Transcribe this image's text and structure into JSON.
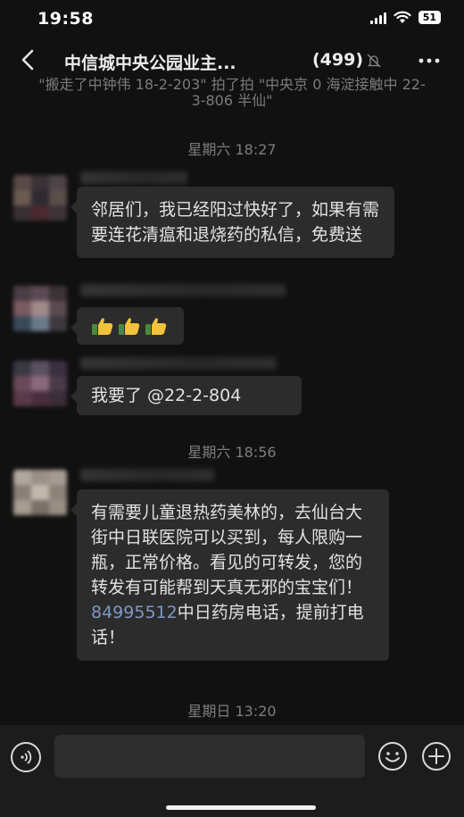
{
  "status_bar": {
    "time": "19:58",
    "battery": "51"
  },
  "chat": {
    "title": "中信城中央公园业主...",
    "member_count": "(499)"
  },
  "system_note": "\"搬走了中钟伟 18-2-203\" 拍了拍 \"中央京 0 海淀接触中 22-3-806 半仙\"",
  "messages": [
    {
      "type": "timestamp",
      "text": "星期六 18:27"
    },
    {
      "type": "text",
      "text": "邻居们，我已经阳过快好了，如果有需要连花清瘟和退烧药的私信，免费送"
    },
    {
      "type": "emoji",
      "emojis": [
        "thumbs-up",
        "thumbs-up",
        "thumbs-up"
      ]
    },
    {
      "type": "text",
      "text": "我要了 @22-2-804"
    },
    {
      "type": "timestamp",
      "text": "星期六 18:56"
    },
    {
      "type": "text",
      "text_before": "有需要儿童退热药美林的，去仙台大街中日联医院可以买到，每人限购一瓶，正常价格。看见的可转发，您的转发有可能帮到天真无邪的宝宝们！",
      "phone": "84995512",
      "text_after": "中日药房电话，提前打电话！"
    },
    {
      "type": "timestamp",
      "text": "星期日 13:20"
    }
  ],
  "input": {
    "placeholder": ""
  },
  "icons": {
    "back": "back-chevron-icon",
    "mute": "mute-bell-icon",
    "more": "more-dots-icon",
    "voice": "voice-icon",
    "emoji": "emoji-icon",
    "plus": "plus-icon"
  },
  "colors": {
    "background": "#111111",
    "bubble": "#2c2c2c",
    "phone_link": "#7f97c5",
    "timestamp": "#7d7d7d"
  }
}
